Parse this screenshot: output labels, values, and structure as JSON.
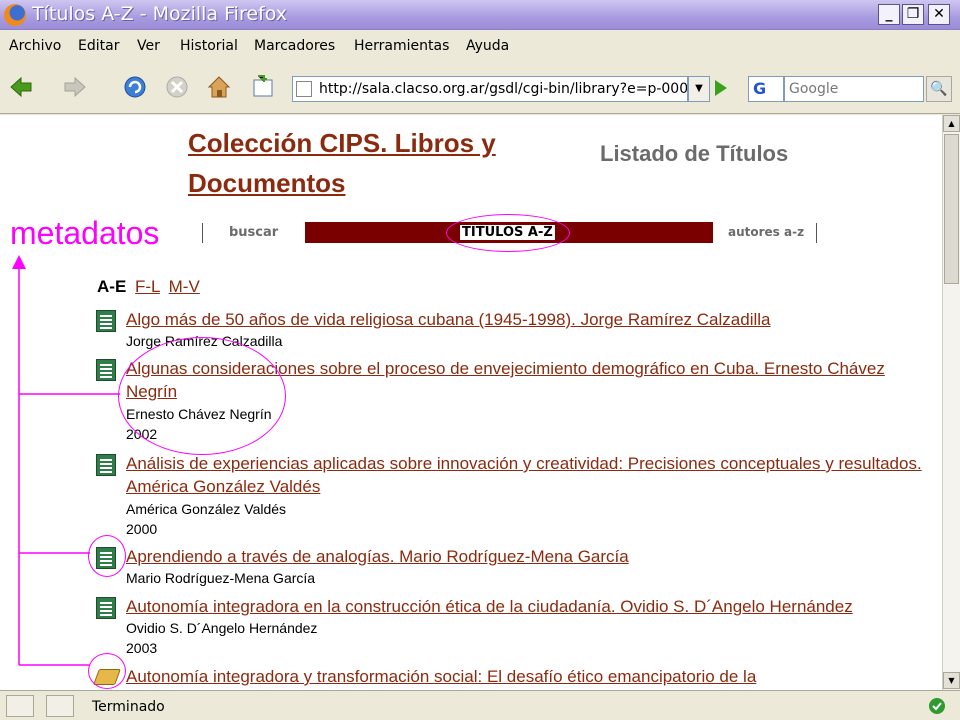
{
  "window": {
    "title": "Títulos A-Z - Mozilla Firefox"
  },
  "menu": [
    "Archivo",
    "Editar",
    "Ver",
    "Historial",
    "Marcadores",
    "Herramientas",
    "Ayuda"
  ],
  "toolbar": {
    "url": "http://sala.clacso.org.ar/gsdl/cgi-bin/library?e=p-000",
    "search_engine": "G",
    "search_placeholder": "Google"
  },
  "page": {
    "collection_title_line1": "Colección CIPS. Libros y",
    "collection_title_line2": "Documentos",
    "page_heading": "Listado de Títulos",
    "annotation_label": "metadatos",
    "nav": {
      "search": "buscar",
      "titles": "TITULOS A-Z",
      "authors": "autores a-z"
    },
    "alpha_current": "A-E",
    "alpha_links": [
      "F-L",
      "M-V"
    ],
    "entries": [
      {
        "title": "Algo más de 50 años de vida religiosa cubana (1945-1998). Jorge Ramírez Calzadilla",
        "author": "Jorge Ramírez Calzadilla",
        "year": ""
      },
      {
        "title": "Algunas consideraciones sobre el proceso de envejecimiento demográfico en Cuba. Ernesto Chávez Negrín",
        "author": "Ernesto Chávez Negrín",
        "year": "2002"
      },
      {
        "title": "Análisis de experiencias aplicadas sobre innovación y creatividad: Precisiones conceptuales y resultados. América González Valdés",
        "author": "América González Valdés",
        "year": "2000"
      },
      {
        "title": "Aprendiendo a través de analogías. Mario Rodríguez-Mena García",
        "author": "Mario Rodríguez-Mena García",
        "year": ""
      },
      {
        "title": "Autonomía integradora en la construcción ética de la ciudadanía. Ovidio S. D´Angelo Hernández",
        "author": "Ovidio S. D´Angelo Hernández",
        "year": "2003"
      },
      {
        "title": "Autonomía integradora y transformación social: El desafío ético emancipatorio de la",
        "author": "",
        "year": ""
      }
    ]
  },
  "status": {
    "text": "Terminado"
  },
  "colors": {
    "link": "#8b2a0e",
    "nav_bar": "#7a0000",
    "annotation": "#ff00ff"
  }
}
